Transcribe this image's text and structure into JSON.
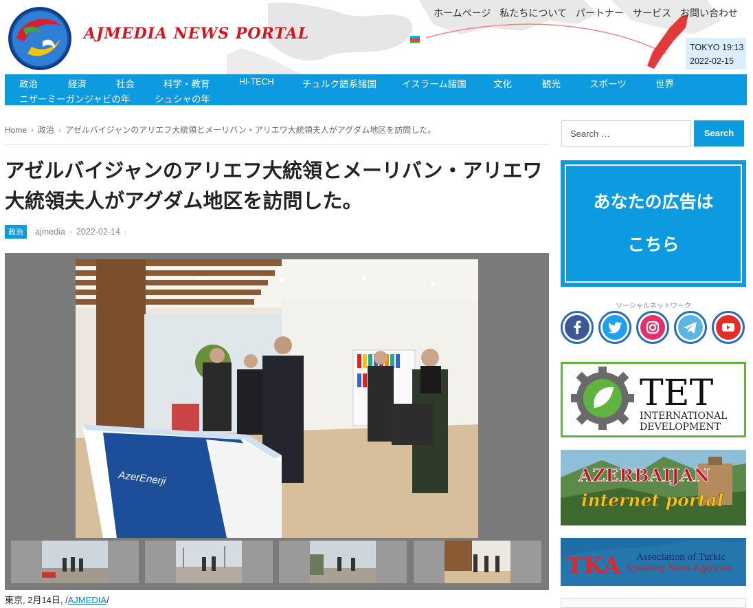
{
  "header": {
    "site_title": "AJMEDIA NEWS PORTAL",
    "top_nav": [
      "ホームページ",
      "私たちについて",
      "パートナー",
      "サービス",
      "お問い合わせ"
    ],
    "clock": {
      "city_time": "TOKYO 19:13",
      "date": "2022-02-15"
    }
  },
  "main_nav": [
    "政治",
    "経済",
    "社会",
    "科学・教育",
    "HI-TECH",
    "チュルク語系諸国",
    "イスラーム諸国",
    "文化",
    "観光",
    "スポーツ",
    "世界",
    "ニザーミーガンジャビの年",
    "シュシャの年"
  ],
  "breadcrumb": {
    "home": "Home",
    "category": "政治",
    "current": "アゼルバイジャンのアリエフ大統領とメーリバン・アリエワ大統領夫人がアグダム地区を訪問した。"
  },
  "article": {
    "title": "アゼルバイジャンのアリエフ大統領とメーリバン・アリエワ大統領夫人がアグダム地区を訪問した。",
    "category_badge": "政治",
    "author": "ajmedia",
    "date": "2022-02-14",
    "photo_sign_text": "AzerEnerji",
    "caption_prefix": "東京, 2月14日, /",
    "caption_link": "AJMEDIA",
    "caption_suffix": "/"
  },
  "sidebar": {
    "search_placeholder": "Search …",
    "search_button": "Search",
    "ad_line1": "あなたの広告は",
    "ad_line2": "こちら",
    "social_title": "ソーシャルネットワーク",
    "social_icons": [
      "facebook-icon",
      "twitter-icon",
      "instagram-icon",
      "telegram-icon",
      "youtube-icon"
    ],
    "banners": {
      "tet_big": "TET",
      "tet_line1": "INTERNATIONAL",
      "tet_line2": "DEVELOPMENT",
      "aze_line1": "AZERBAIJAN",
      "aze_line2": "internet portal",
      "tka_logo": "TKA",
      "tka_line1": "Association of Turkic",
      "tka_line2": "Speaking News Agencies"
    }
  },
  "colors": {
    "accent": "#0d9be0",
    "title_red": "#d6141d",
    "ad_bg": "#0d9be0"
  }
}
